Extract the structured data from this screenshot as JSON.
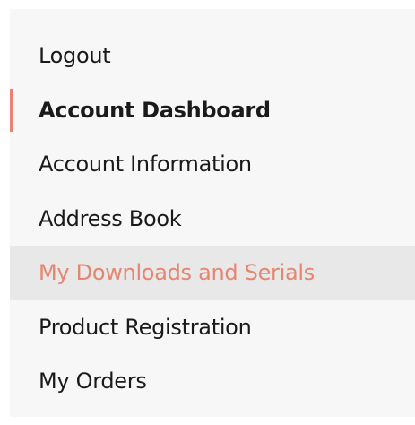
{
  "nav": {
    "items": [
      {
        "label": "Logout"
      },
      {
        "label": "Account Dashboard"
      },
      {
        "label": "Account Information"
      },
      {
        "label": "Address Book"
      },
      {
        "label": "My Downloads and Serials"
      },
      {
        "label": "Product Registration"
      },
      {
        "label": "My Orders"
      }
    ],
    "active_item": "Account Dashboard",
    "hover_item": "My Downloads and Serials"
  },
  "colors": {
    "accent": "#e8846f",
    "panel_bg": "#f7f7f7",
    "highlight_bg": "#e8e8e8",
    "text": "#1a1a1a"
  }
}
